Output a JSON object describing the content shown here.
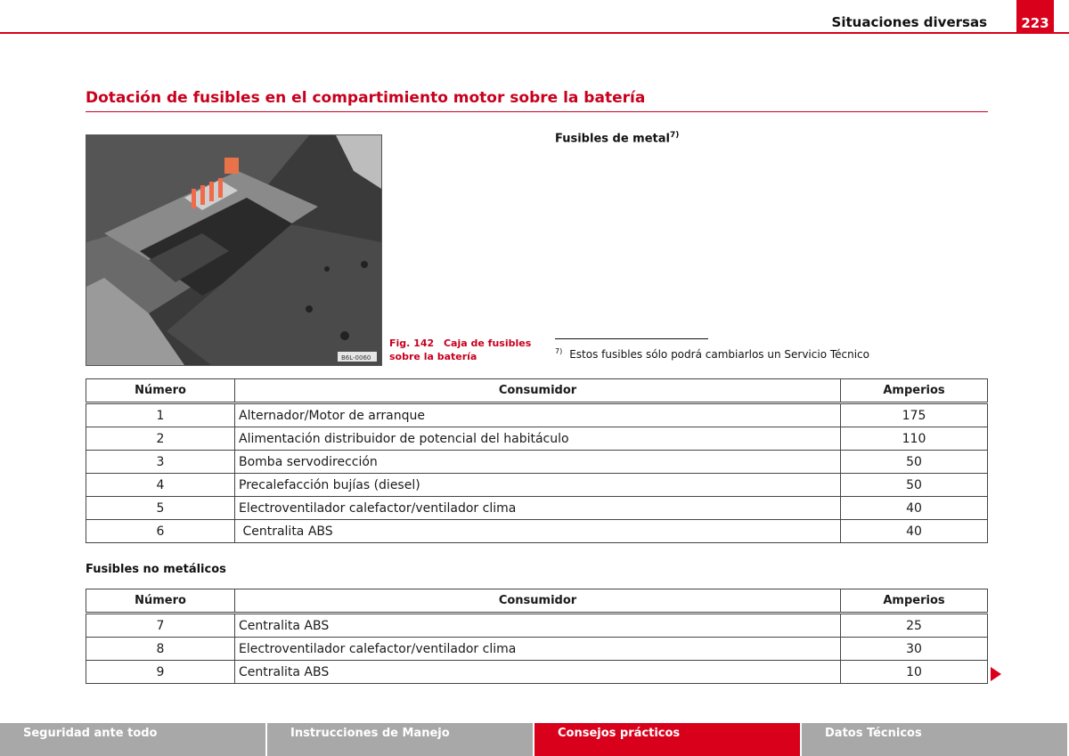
{
  "header": {
    "section": "Situaciones diversas",
    "page_number": "223"
  },
  "title": "Dotación de fusibles en el compartimiento motor sobre la batería",
  "figure": {
    "label": "Fig. 142",
    "caption": "Caja de fusibles sobre la batería",
    "caption_line1": "Caja de fusibles",
    "caption_line2": "sobre la batería",
    "image_code": "B6L-0060"
  },
  "metal_section": {
    "title": "Fusibles de metal",
    "footnote_ref": "7)"
  },
  "footnote": {
    "marker": "7)",
    "text": "Estos fusibles sólo podrá cambiarlos un Servicio Técnico"
  },
  "columns": {
    "number": "Número",
    "consumer": "Consumidor",
    "amps": "Amperios"
  },
  "metal_table": [
    {
      "num": "1",
      "consumer": "Alternador/Motor de arranque",
      "amps": "175"
    },
    {
      "num": "2",
      "consumer": "Alimentación distribuidor de potencial del habitáculo",
      "amps": "110"
    },
    {
      "num": "3",
      "consumer": "Bomba servodirección",
      "amps": "50"
    },
    {
      "num": "4",
      "consumer": "Precalefacción bujías (diesel)",
      "amps": "50"
    },
    {
      "num": "5",
      "consumer": "Electroventilador calefactor/ventilador clima",
      "amps": "40"
    },
    {
      "num": "6",
      "consumer": " Centralita ABS",
      "amps": "40"
    }
  ],
  "nonmetal_section": {
    "title": "Fusibles no metálicos"
  },
  "nonmetal_table": [
    {
      "num": "7",
      "consumer": "Centralita ABS",
      "amps": "25"
    },
    {
      "num": "8",
      "consumer": "Electroventilador calefactor/ventilador clima",
      "amps": "30"
    },
    {
      "num": "9",
      "consumer": "Centralita ABS",
      "amps": "10"
    }
  ],
  "nav": {
    "tabs": [
      {
        "label": "Seguridad ante todo",
        "active": false
      },
      {
        "label": "Instrucciones de Manejo",
        "active": false
      },
      {
        "label": "Consejos prácticos",
        "active": true
      },
      {
        "label": "Datos Técnicos",
        "active": false
      }
    ]
  },
  "colors": {
    "accent": "#d9001b",
    "nav_inactive": "#a8a8a8"
  },
  "icons": {
    "next_page": "next-page-arrow-icon"
  }
}
